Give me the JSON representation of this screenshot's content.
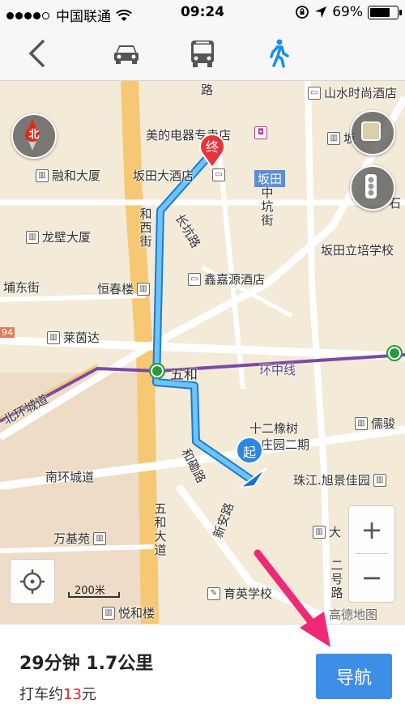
{
  "status_bar": {
    "carrier": "中国联通",
    "time": "09:24",
    "battery": "69%",
    "battery_level": 0.69
  },
  "nav_bar": {
    "back_icon": "chevron-left-icon",
    "modes": [
      {
        "name": "car-icon",
        "selected": false
      },
      {
        "name": "bus-icon",
        "selected": false
      },
      {
        "name": "walk-icon",
        "selected": true
      }
    ],
    "accent": "#1a8fe8"
  },
  "map": {
    "compass_label": "北",
    "end_marker": "终",
    "start_marker": "起",
    "scale": "200米",
    "labels": {
      "shanshui": "山水时尚酒店",
      "meidi": "美的电器专卖店",
      "ronghe": "融和大厦",
      "bantian_hotel": "坂田大酒店",
      "bantian": "坂田",
      "banba": "坂",
      "longbi": "龙壁大厦",
      "changkeng": "长坑路",
      "zhongkeng": "中坑街",
      "bantian_school": "坂田立培学校",
      "pudong": "埔东街",
      "hengchun": "恒春楼",
      "xinjiayuan": "鑫嘉源酒店",
      "laiyinda": "莱茵达",
      "wuhe": "五和",
      "huanzhong": "环中线",
      "beihuan": "北环城道",
      "shierxiangshu": "十二橡树",
      "huayuan2": "庄园二期",
      "rujun": "儒骏",
      "nanhuan": "南环城道",
      "zhujiang": "珠江.旭景佳园",
      "hexi": "和西街",
      "hexilu": "和磡路",
      "wuhedadao": "五和大道",
      "xinanlu": "新安路",
      "erhaolu": "二号路",
      "wanjiyuan": "万基苑",
      "da": "大",
      "yuying": "育英学校",
      "yuehe": "悦和楼",
      "gaode": "高德地图",
      "shi": "石",
      "lu_top": "路",
      "num94": "94"
    },
    "zoom_in": "+",
    "zoom_out": "−"
  },
  "summary": {
    "duration_distance": "29分钟 1.7公里",
    "taxi_prefix": "打车约",
    "taxi_price": "13",
    "taxi_suffix": "元",
    "navigate_label": "导航"
  }
}
